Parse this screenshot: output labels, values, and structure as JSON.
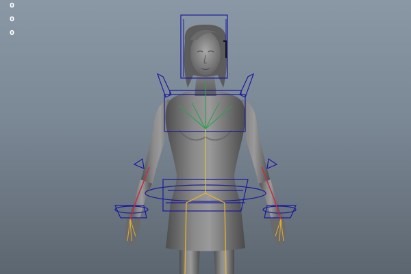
{
  "viewport": {
    "background_top": "#8a98a6",
    "background_bottom": "#5c6670"
  },
  "hud": {
    "lines": [
      "0",
      "0",
      "0"
    ],
    "color": "#ffffff"
  },
  "rig": {
    "control_color": "#1a1aa0",
    "spine_joint_color": "#d4c040",
    "neck_joint_color": "#2fa050",
    "leg_joint_color": "#e0b030",
    "arm_joint_color": "#c0304a",
    "mesh_color": "#6e6e6e"
  }
}
